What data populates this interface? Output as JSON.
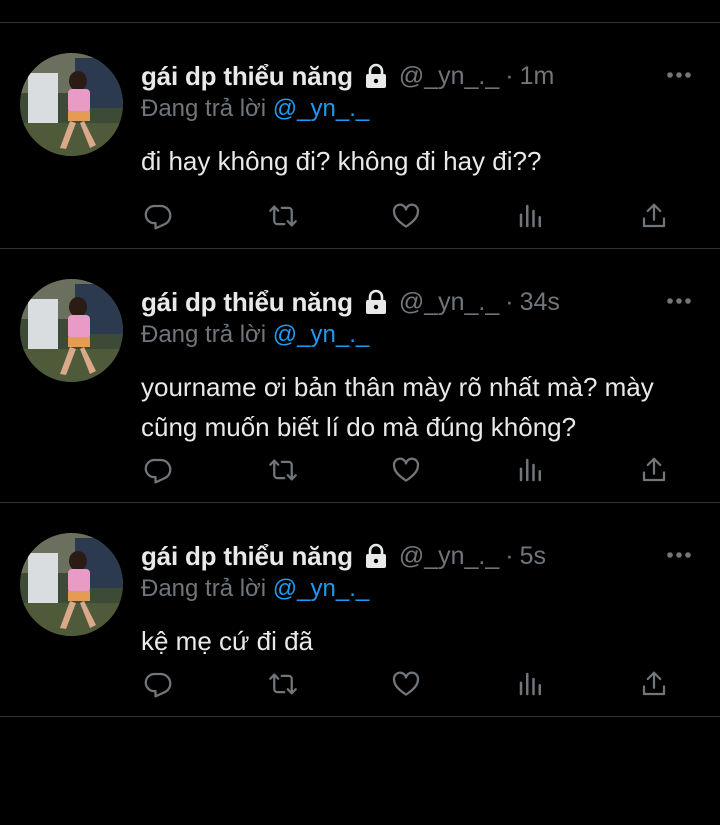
{
  "colors": {
    "background": "#000000",
    "text_primary": "#e7e9ea",
    "text_secondary": "#71767b",
    "accent": "#1d9bf0",
    "divider": "#2f3336"
  },
  "tweets": [
    {
      "name": "gái dp thiểu năng",
      "handle": "@_yn_._",
      "separator": "·",
      "time": "1m",
      "reply_prefix": "Đang trả lời ",
      "reply_handle": "@_yn_._",
      "text": "đi hay không đi? không đi hay đi??",
      "icons": [
        "lock-icon",
        "more-icon",
        "reply-icon",
        "retweet-icon",
        "like-icon",
        "views-icon",
        "share-icon"
      ]
    },
    {
      "name": "gái dp thiểu năng",
      "handle": "@_yn_._",
      "separator": "·",
      "time": "34s",
      "reply_prefix": "Đang trả lời ",
      "reply_handle": "@_yn_._",
      "text": "yourname ơi bản thân mày rõ nhất mà? mày cũng muốn biết lí do mà đúng không?",
      "icons": [
        "lock-icon",
        "more-icon",
        "reply-icon",
        "retweet-icon",
        "like-icon",
        "views-icon",
        "share-icon"
      ]
    },
    {
      "name": "gái dp thiểu năng",
      "handle": "@_yn_._",
      "separator": "·",
      "time": "5s",
      "reply_prefix": "Đang trả lời ",
      "reply_handle": "@_yn_._",
      "text": "kệ mẹ cứ đi đã",
      "icons": [
        "lock-icon",
        "more-icon",
        "reply-icon",
        "retweet-icon",
        "like-icon",
        "views-icon",
        "share-icon"
      ]
    }
  ]
}
